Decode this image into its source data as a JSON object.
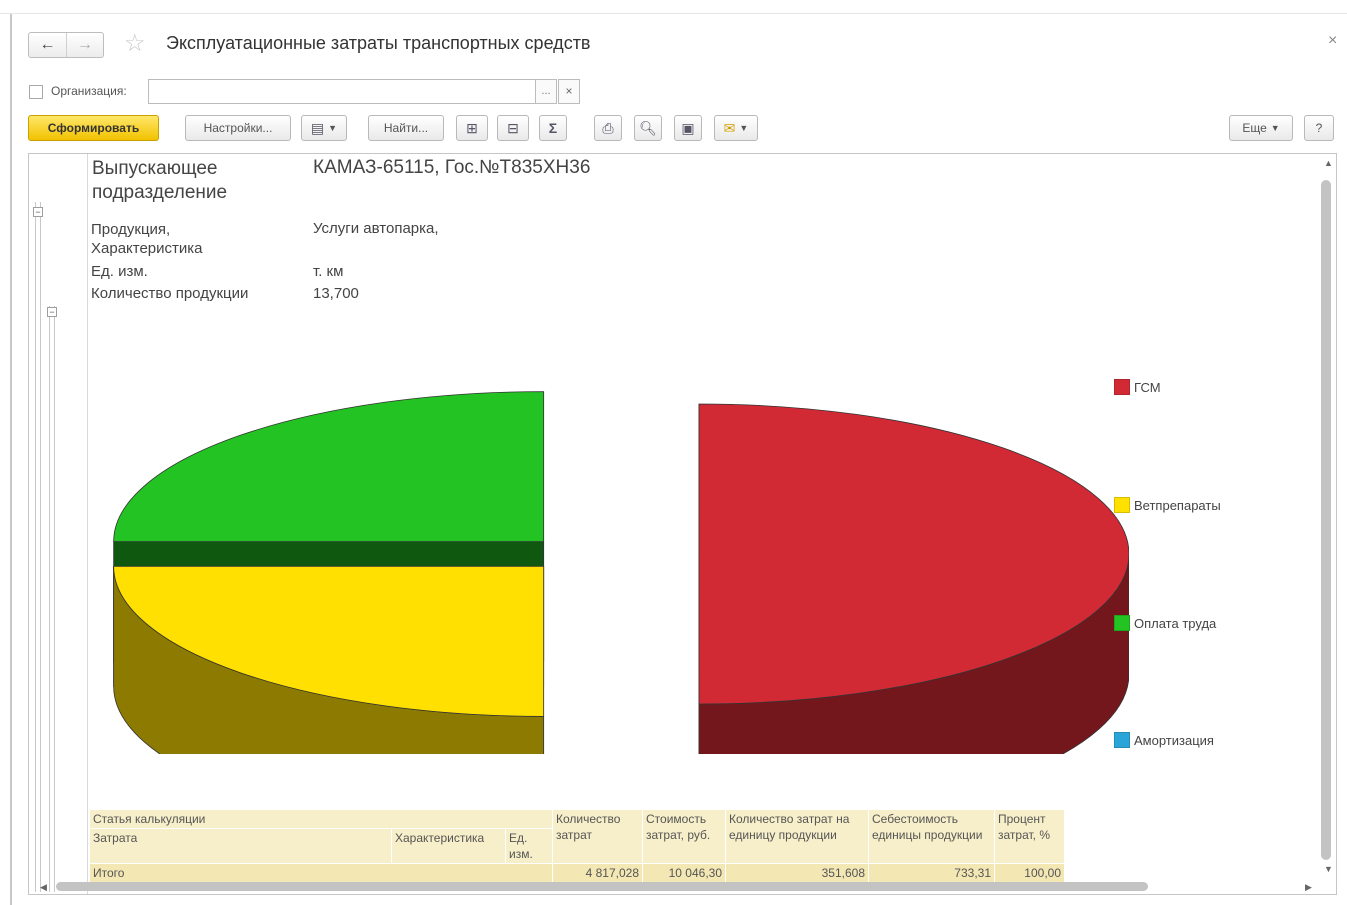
{
  "window": {
    "title": "Эксплуатационные затраты транспортных средств",
    "back_label": "←",
    "forward_label": "→",
    "star_label": "☆",
    "close_label": "×"
  },
  "filter": {
    "org_label": "Организация:",
    "org_value": "",
    "select_label": "...",
    "clear_label": "×"
  },
  "toolbar": {
    "generate": "Сформировать",
    "settings": "Настройки...",
    "find": "Найти...",
    "more": "Еще",
    "help": "?"
  },
  "report": {
    "dept_label": "Выпускающее подразделение",
    "dept_value": "КАМАЗ-65115, Гос.№Т835ХН36",
    "product_label": "Продукция, Характеристика",
    "product_value": "Услуги автопарка,",
    "unit_label": "Ед. изм.",
    "unit_value": "т. км",
    "qty_label": "Количество продукции",
    "qty_value": "13,700"
  },
  "chart_data": {
    "type": "pie",
    "style": "3d-exploded",
    "title": "",
    "legend_position": "right",
    "categories": [
      "ГСМ",
      "Ветпрепараты",
      "Оплата труда",
      "Амортизация"
    ],
    "values": [
      50,
      25,
      25,
      0
    ],
    "colors": [
      "#d12a35",
      "#ffe000",
      "#22c322",
      "#2aa5d8"
    ]
  },
  "table": {
    "h_article": "Статья калькуляции",
    "h_cost_item": "Затрата",
    "h_characteristic": "Характеристика",
    "h_unit": "Ед. изм.",
    "h_qty": "Количество затрат",
    "h_cost": "Стоимость затрат, руб.",
    "h_qty_per_unit": "Количество затрат на единицу продукции",
    "h_unit_cost": "Себестоимость единицы продукции",
    "h_percent": "Процент затрат, %",
    "total": {
      "label": "Итого",
      "qty": "4 817,028",
      "cost": "10 046,30",
      "qty_per_unit": "351,608",
      "unit_cost": "733,31",
      "percent": "100,00"
    }
  }
}
